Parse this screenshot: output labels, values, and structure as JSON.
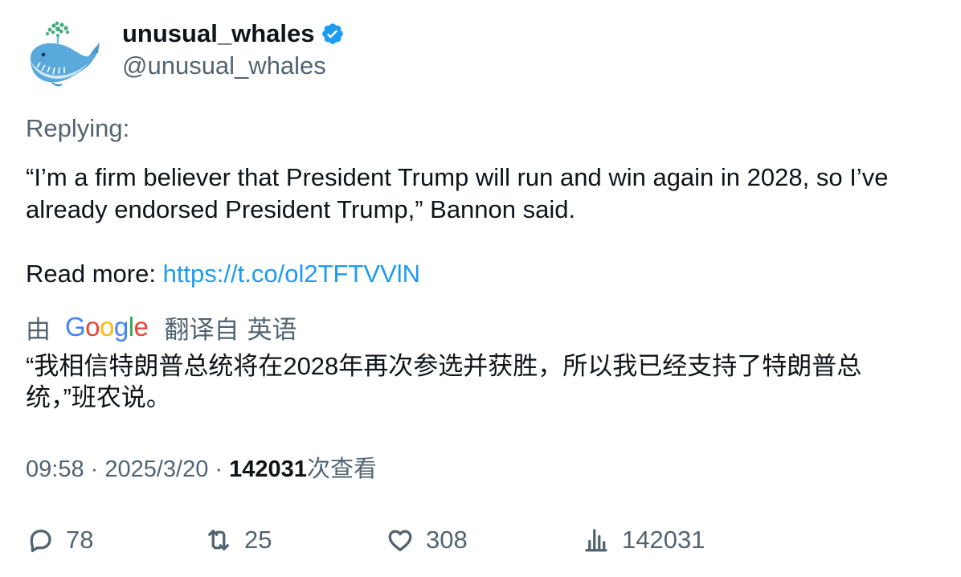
{
  "user": {
    "display_name": "unusual_whales",
    "handle": "@unusual_whales",
    "verified": true,
    "avatar_icon": "whale-avatar-icon",
    "verified_icon": "verified-badge-icon"
  },
  "tweet": {
    "replying_label": "Replying:",
    "text": "“I’m a firm believer that President Trump will run and win again in 2028, so I’ve already endorsed President Trump,” Bannon said.",
    "read_more_label": "Read more: ",
    "link_text": "https://t.co/ol2TFTVVlN"
  },
  "translation": {
    "by_label": "由",
    "provider": "Google",
    "from_label": "翻译自",
    "language": "英语",
    "text": "“我相信特朗普总统将在2028年再次参选并获胜，所以我已经支持了特朗普总统，”班农说。"
  },
  "meta": {
    "time": "09:58",
    "separator": " · ",
    "date": "2025/3/20",
    "views_count": "142031",
    "views_label": "次查看"
  },
  "actions": {
    "replies": "78",
    "retweets": "25",
    "likes": "308",
    "views": "142031"
  },
  "colors": {
    "text_primary": "#0f1419",
    "text_secondary": "#536471",
    "link": "#1d9bf0",
    "verified": "#1d9bf0"
  }
}
